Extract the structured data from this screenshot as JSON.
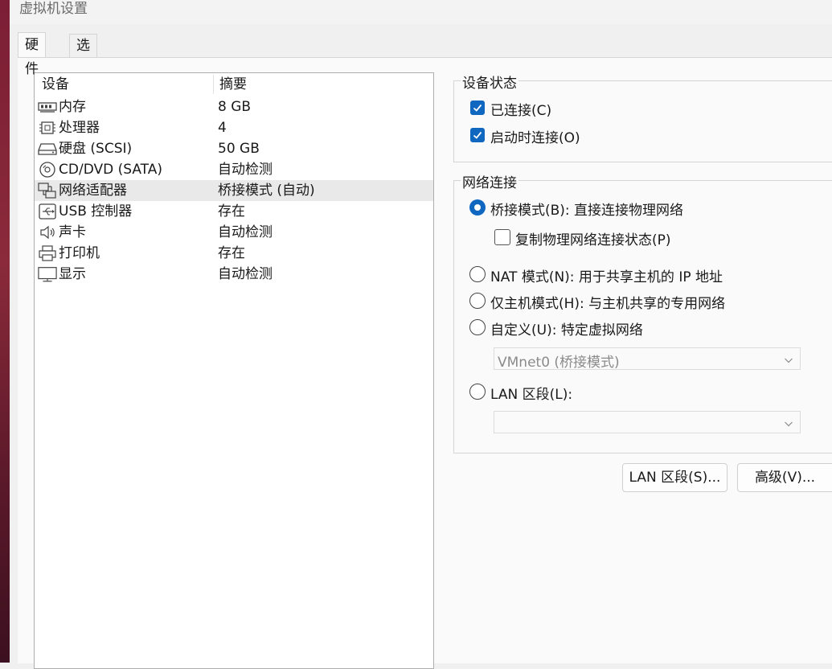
{
  "window": {
    "title": "虚拟机设置"
  },
  "tabs": [
    {
      "label": "硬件",
      "active": true
    },
    {
      "label": "选项",
      "active": false
    }
  ],
  "device_table": {
    "headers": {
      "device": "设备",
      "summary": "摘要"
    },
    "rows": [
      {
        "icon": "memory-icon",
        "name": "内存",
        "summary": "8 GB"
      },
      {
        "icon": "cpu-icon",
        "name": "处理器",
        "summary": "4"
      },
      {
        "icon": "harddisk-icon",
        "name": "硬盘 (SCSI)",
        "summary": "50 GB"
      },
      {
        "icon": "cd-dvd-icon",
        "name": "CD/DVD (SATA)",
        "summary": "自动检测"
      },
      {
        "icon": "network-adapter-icon",
        "name": "网络适配器",
        "summary": "桥接模式 (自动)",
        "selected": true
      },
      {
        "icon": "usb-icon",
        "name": "USB 控制器",
        "summary": "存在"
      },
      {
        "icon": "sound-card-icon",
        "name": "声卡",
        "summary": "自动检测"
      },
      {
        "icon": "printer-icon",
        "name": "打印机",
        "summary": "存在"
      },
      {
        "icon": "display-icon",
        "name": "显示",
        "summary": "自动检测"
      }
    ]
  },
  "device_status": {
    "title": "设备状态",
    "connected": {
      "label": "已连接(C)",
      "checked": true
    },
    "connect_at_power_on": {
      "label": "启动时连接(O)",
      "checked": true
    }
  },
  "network_connection": {
    "title": "网络连接",
    "bridged": {
      "label": "桥接模式(B): 直接连接物理网络",
      "selected": true
    },
    "replicate_state": {
      "label": "复制物理网络连接状态(P)",
      "checked": false
    },
    "nat": {
      "label": "NAT 模式(N): 用于共享主机的 IP 地址",
      "selected": false
    },
    "host_only": {
      "label": "仅主机模式(H): 与主机共享的专用网络",
      "selected": false
    },
    "custom": {
      "label": "自定义(U): 特定虚拟网络",
      "selected": false
    },
    "custom_select_value": "VMnet0 (桥接模式)",
    "lan_segment": {
      "label": "LAN 区段(L):",
      "selected": false
    },
    "lan_select_value": ""
  },
  "buttons": {
    "lan_segments": "LAN 区段(S)...",
    "advanced": "高级(V)..."
  },
  "colors": {
    "accent": "#0f67c0",
    "selected_row": "#e9e9e9",
    "panel": "#fafafa"
  }
}
